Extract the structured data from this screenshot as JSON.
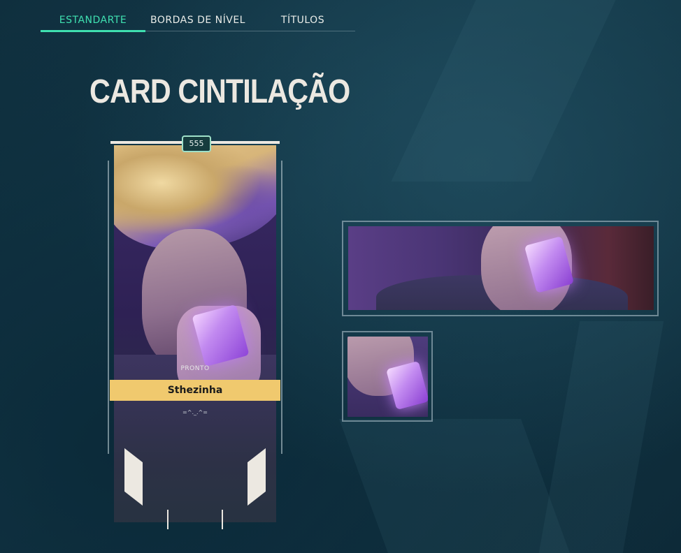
{
  "tabs": [
    {
      "label": "ESTANDARTE",
      "active": true
    },
    {
      "label": "BORDAS DE NÍVEL",
      "active": false
    },
    {
      "label": "TÍTULOS",
      "active": false
    }
  ],
  "title": "CARD CINTILAÇÃO",
  "card": {
    "level": "555",
    "status": "PRONTO",
    "player_name": "Sthezinha",
    "player_title": "=^._.^="
  },
  "colors": {
    "accent": "#3fe0b0",
    "name_bar": "#f0c96e",
    "title_text": "#ece8e1"
  }
}
